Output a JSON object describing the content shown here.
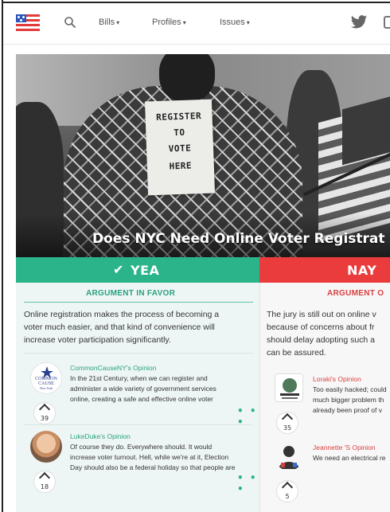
{
  "nav": {
    "items": [
      {
        "label": "Bills"
      },
      {
        "label": "Profiles"
      },
      {
        "label": "Issues"
      }
    ],
    "caret": "▾"
  },
  "hero": {
    "title": "Does NYC Need Online Voter Registrat",
    "sign_lines": [
      "REGISTER",
      "TO",
      "VOTE",
      "HERE"
    ]
  },
  "yea": {
    "check": "✔",
    "label": "YEA",
    "heading": "ARGUMENT IN FAVOR",
    "argument_lines": [
      "Online registration makes the process of becoming a",
      "voter much easier, and that kind of convenience will",
      "increase voter participation significantly."
    ],
    "opinions": [
      {
        "name": "CommonCauseNY's Opinion",
        "lines": [
          "In the 21st Century, when we can register and",
          "administer a wide variety of government services",
          "online, creating a safe and effective online voter"
        ],
        "votes": "39",
        "avatar_text": [
          "COMMON",
          "CAUSE",
          "New York"
        ]
      },
      {
        "name": "LukeDuke's Opinion",
        "lines": [
          "Of course they do. Everywhere should. It would",
          "increase voter turnout. Hell, while we're at it, Election",
          "Day should also be a federal holiday so that people are"
        ],
        "votes": "18"
      }
    ],
    "more": "• • •"
  },
  "nay": {
    "label": "NAY",
    "heading": "ARGUMENT O",
    "argument_lines": [
      "The jury is still out on online v",
      "because of concerns about fr",
      "should delay adopting such a",
      "can be assured."
    ],
    "opinions": [
      {
        "name": "Loraki's Opinion",
        "lines": [
          "Too easily hacked; could",
          "much bigger problem th",
          "already been proof of v"
        ],
        "votes": "35"
      },
      {
        "name": "Jeannette 'S Opinion",
        "lines": [
          "We need an electrical re"
        ],
        "votes": "5"
      }
    ]
  },
  "colors": {
    "yea": "#2bb38a",
    "nay": "#ea3c3c",
    "yea_bg": "#eef6f5"
  }
}
